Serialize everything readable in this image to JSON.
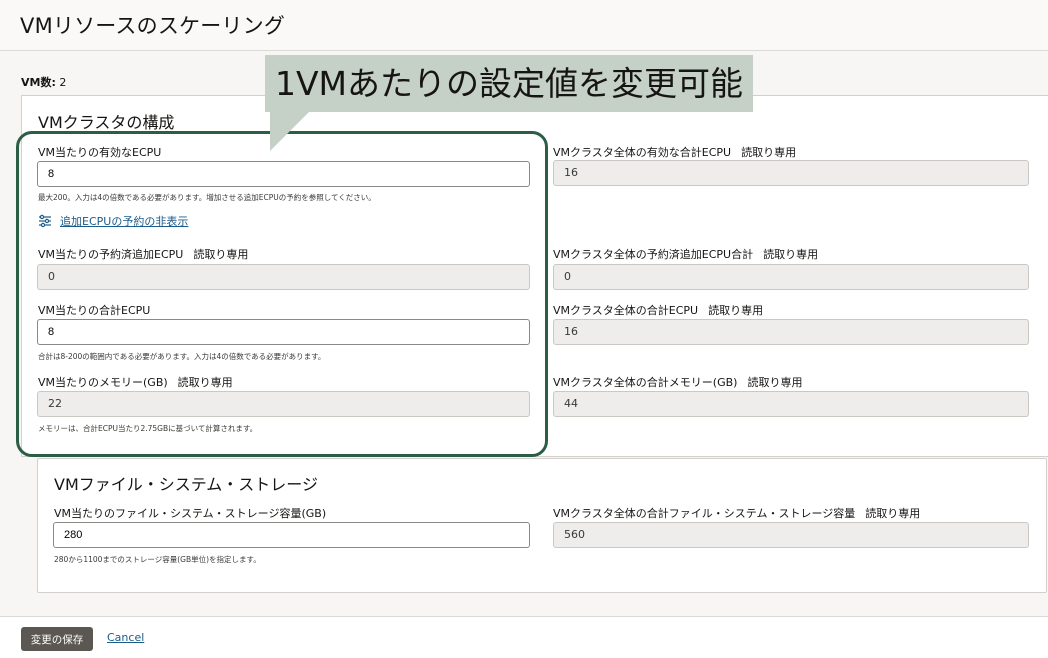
{
  "page": {
    "title": "VMリソースのスケーリング"
  },
  "vm_count": {
    "label": "VM数:",
    "value": "2"
  },
  "callout": {
    "text": "1VMあたりの設定値を変更可能"
  },
  "cluster_config": {
    "title": "VMクラスタの構成",
    "per_vm_ecpu": {
      "label": "VM当たりの有効なECPU",
      "value": "8",
      "hint": "最大200。入力は4の倍数である必要があります。増加させる追加ECPUの予約を参照してください。"
    },
    "cluster_ecpu": {
      "label": "VMクラスタ全体の有効な合計ECPU",
      "ro": "読取り専用",
      "value": "16"
    },
    "toggle_link": {
      "label": "追加ECPUの予約の非表示"
    },
    "per_vm_reserved": {
      "label": "VM当たりの予約済追加ECPU",
      "ro": "読取り専用",
      "value": "0"
    },
    "cluster_reserved": {
      "label": "VMクラスタ全体の予約済追加ECPU合計",
      "ro": "読取り専用",
      "value": "0"
    },
    "per_vm_total": {
      "label": "VM当たりの合計ECPU",
      "value": "8",
      "hint": "合計は8-200の範囲内である必要があります。入力は4の倍数である必要があります。"
    },
    "cluster_total": {
      "label": "VMクラスタ全体の合計ECPU",
      "ro": "読取り専用",
      "value": "16"
    },
    "per_vm_memory": {
      "label": "VM当たりのメモリー(GB)",
      "ro": "読取り専用",
      "value": "22",
      "hint": "メモリーは、合計ECPU当たり2.75GBに基づいて計算されます。"
    },
    "cluster_memory": {
      "label": "VMクラスタ全体の合計メモリー(GB)",
      "ro": "読取り専用",
      "value": "44"
    }
  },
  "storage": {
    "title": "VMファイル・システム・ストレージ",
    "per_vm": {
      "label": "VM当たりのファイル・システム・ストレージ容量(GB)",
      "value": "280",
      "hint": "280から1100までのストレージ容量(GB単位)を指定します。"
    },
    "cluster": {
      "label": "VMクラスタ全体の合計ファイル・システム・ストレージ容量",
      "ro": "読取り専用",
      "value": "560"
    }
  },
  "footer": {
    "save_label": "変更の保存",
    "cancel_label": "Cancel"
  }
}
